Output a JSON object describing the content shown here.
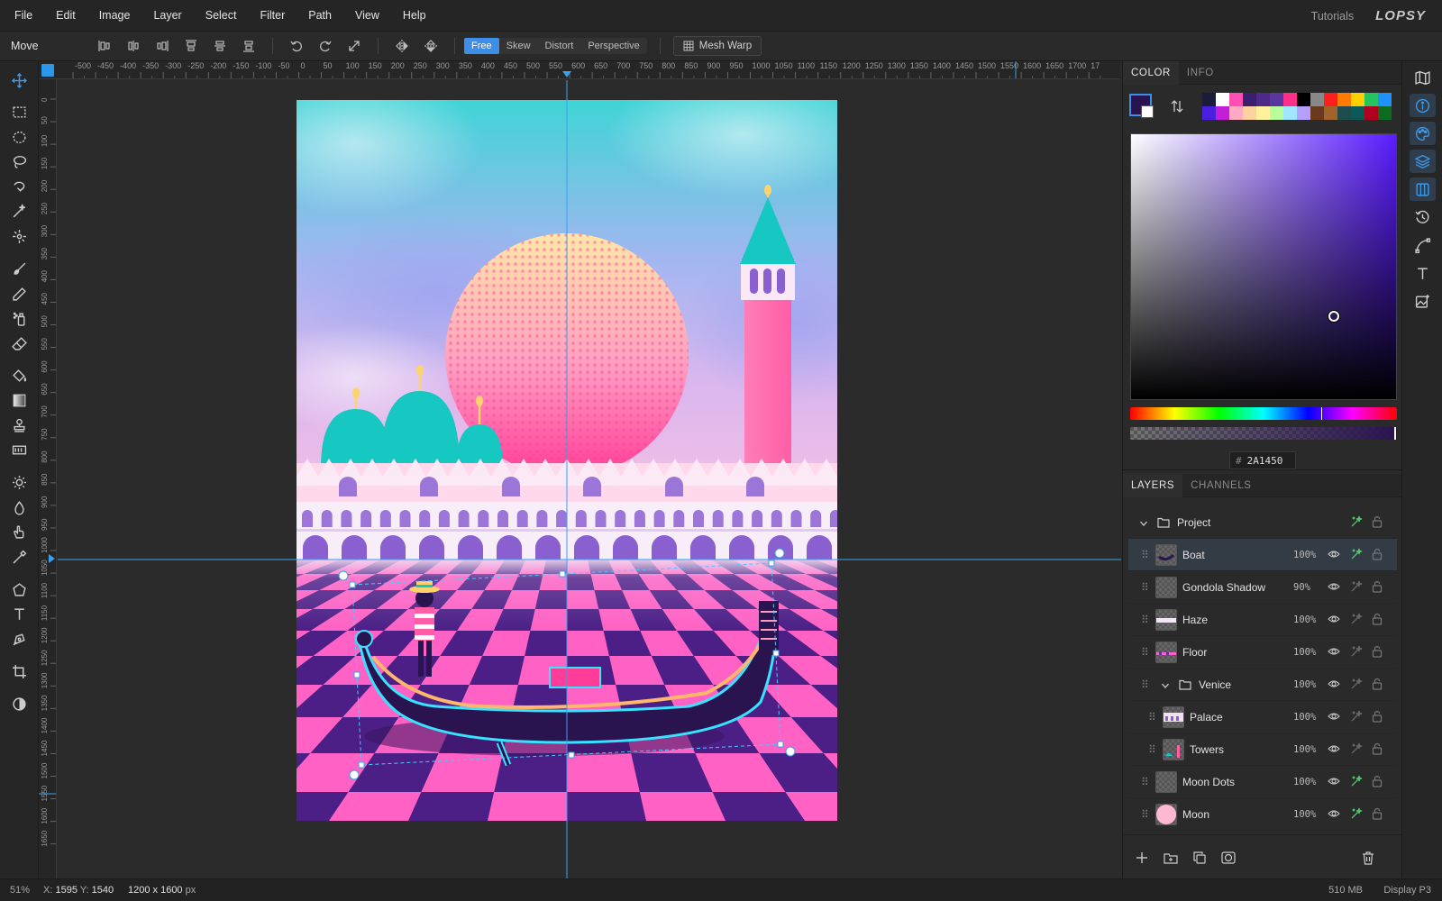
{
  "menubar": {
    "items": [
      "File",
      "Edit",
      "Image",
      "Layer",
      "Select",
      "Filter",
      "Path",
      "View",
      "Help"
    ],
    "tutorials": "Tutorials",
    "logo": "LOPSY"
  },
  "optbar": {
    "tool_name": "Move",
    "modes": [
      "Free",
      "Skew",
      "Distort",
      "Perspective"
    ],
    "active_mode": "Free",
    "mesh_warp": "Mesh Warp"
  },
  "ruler": {
    "top_labels": [
      "-500",
      "-450",
      "-400",
      "-350",
      "-300",
      "-250",
      "-200",
      "-150",
      "-100",
      "-50",
      "0",
      "50",
      "100",
      "150",
      "200",
      "250",
      "300",
      "350",
      "400",
      "450",
      "500",
      "550",
      "600",
      "650",
      "700",
      "750",
      "800",
      "850",
      "900",
      "950",
      "1000",
      "1050",
      "1100",
      "1150",
      "1200",
      "1250",
      "1300",
      "1350",
      "1400",
      "1450",
      "1500",
      "1550",
      "1600",
      "1650",
      "1700",
      "17"
    ],
    "left_labels": [
      "0",
      "50",
      "100",
      "150",
      "200",
      "250",
      "300",
      "350",
      "400",
      "450",
      "500",
      "550",
      "600",
      "650",
      "700",
      "750",
      "800",
      "850",
      "900",
      "950",
      "1000",
      "1050",
      "1100",
      "1150",
      "1200",
      "1250",
      "1300",
      "1350",
      "1400",
      "1450",
      "1500",
      "1550",
      "1600",
      "1650"
    ]
  },
  "color_panel": {
    "tabs": [
      "COLOR",
      "INFO"
    ],
    "active_tab": "COLOR",
    "foreground": "#2A1450",
    "background": "#FFFFFF",
    "hex_label": "#",
    "hex_value": "2A1450",
    "palette": [
      "#1b1b3a",
      "#ffffff",
      "#ff4fb3",
      "#3a1f6e",
      "#4b2a8a",
      "#5a36a0",
      "#ff2e8a",
      "#000000",
      "#888888",
      "#ff1e1e",
      "#ff7a00",
      "#ffd000",
      "#22c55e",
      "#1e90ff",
      "#4a1fe0",
      "#c21fd6",
      "#ffa9c2",
      "#ffd2a0",
      "#fff29a",
      "#b7ff9a",
      "#a0e6ff",
      "#b6a0ff",
      "#6b3a1e",
      "#a0642a",
      "#1f4d4d",
      "#0b5a5a",
      "#b00020",
      "#0b6b1e"
    ],
    "hue_position": 0.72,
    "alpha": 1.0
  },
  "layers_panel": {
    "tabs": [
      "LAYERS",
      "CHANNELS"
    ],
    "active_tab": "LAYERS",
    "layers": [
      {
        "name": "Project",
        "opacity": "",
        "group": true,
        "indent": 0,
        "visible": false,
        "fx": true,
        "selected": false
      },
      {
        "name": "Boat",
        "opacity": "100%",
        "group": false,
        "indent": 1,
        "visible": true,
        "fx": true,
        "selected": true
      },
      {
        "name": "Gondola Shadow",
        "opacity": "90%",
        "group": false,
        "indent": 1,
        "visible": true,
        "fx": false,
        "selected": false
      },
      {
        "name": "Haze",
        "opacity": "100%",
        "group": false,
        "indent": 1,
        "visible": true,
        "fx": false,
        "selected": false
      },
      {
        "name": "Floor",
        "opacity": "100%",
        "group": false,
        "indent": 1,
        "visible": true,
        "fx": false,
        "selected": false
      },
      {
        "name": "Venice",
        "opacity": "100%",
        "group": true,
        "indent": 1,
        "visible": true,
        "fx": false,
        "selected": false
      },
      {
        "name": "Palace",
        "opacity": "100%",
        "group": false,
        "indent": 2,
        "visible": true,
        "fx": false,
        "selected": false
      },
      {
        "name": "Towers",
        "opacity": "100%",
        "group": false,
        "indent": 2,
        "visible": true,
        "fx": false,
        "selected": false
      },
      {
        "name": "Moon Dots",
        "opacity": "100%",
        "group": false,
        "indent": 1,
        "visible": true,
        "fx": true,
        "selected": false
      },
      {
        "name": "Moon",
        "opacity": "100%",
        "group": false,
        "indent": 1,
        "visible": true,
        "fx": true,
        "selected": false
      }
    ]
  },
  "status": {
    "zoom": "51%",
    "x_label": "X:",
    "x_value": "1595",
    "y_label": "Y:",
    "y_value": "1540",
    "doc_size": "1200 x 1600",
    "doc_unit": "px",
    "memory": "510 MB",
    "color_profile": "Display P3"
  },
  "colors": {
    "accent": "#3d8ee6",
    "guide": "#3aa0e8",
    "fx_green": "#4cc46a"
  }
}
